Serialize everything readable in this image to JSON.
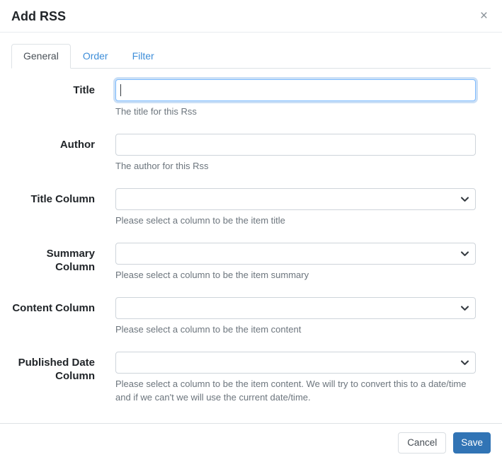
{
  "modal": {
    "title": "Add RSS",
    "close_icon": "×"
  },
  "tabs": [
    {
      "label": "General",
      "active": true
    },
    {
      "label": "Order",
      "active": false
    },
    {
      "label": "Filter",
      "active": false
    }
  ],
  "form": {
    "fields": [
      {
        "label": "Title",
        "type": "text",
        "value": "",
        "placeholder": "",
        "focused": true,
        "help": "The title for this Rss"
      },
      {
        "label": "Author",
        "type": "text",
        "value": "",
        "placeholder": "",
        "focused": false,
        "help": "The author for this Rss"
      },
      {
        "label": "Title Column",
        "type": "select",
        "value": "",
        "help": "Please select a column to be the item title"
      },
      {
        "label": "Summary Column",
        "type": "select",
        "value": "",
        "help": "Please select a column to be the item summary"
      },
      {
        "label": "Content Column",
        "type": "select",
        "value": "",
        "help": "Please select a column to be the item content"
      },
      {
        "label": "Published Date Column",
        "type": "select",
        "value": "",
        "help": "Please select a column to be the item content. We will try to convert this to a date/time and if we can't we will use the current date/time."
      }
    ]
  },
  "footer": {
    "cancel_label": "Cancel",
    "save_label": "Save"
  },
  "colors": {
    "link_blue": "#3e8ed9",
    "save_blue": "#3174b5",
    "active_tab_text": "#495057",
    "help_gray": "#6c757d",
    "border_gray": "#ced4da",
    "divider_gray": "#dee2e6",
    "focus_ring_blue": "#80bdff"
  }
}
